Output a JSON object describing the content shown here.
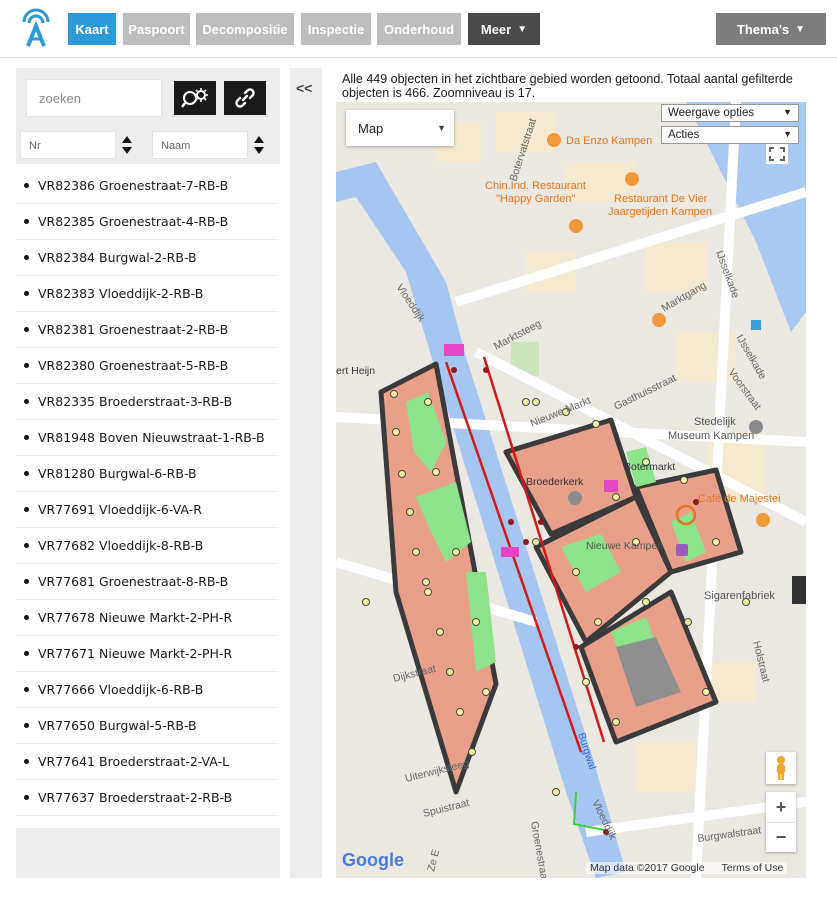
{
  "nav": {
    "tabs": [
      {
        "label": "Kaart"
      },
      {
        "label": "Paspoort"
      },
      {
        "label": "Decompositie"
      },
      {
        "label": "Inspectie"
      },
      {
        "label": "Onderhoud"
      },
      {
        "label": "Meer"
      }
    ],
    "themes_label": "Thema's",
    "active_tab": "Kaart",
    "colors": {
      "active": "#2d9ad8",
      "inactive": "#bdbdbd",
      "dark": "#4a4a4a"
    }
  },
  "sidebar": {
    "search_placeholder": "zoeken",
    "sort_nr": "Nr",
    "sort_naam": "Naam",
    "items": [
      {
        "id": "VR82386",
        "name": "Groenestraat-7-RB-B"
      },
      {
        "id": "VR82385",
        "name": "Groenestraat-4-RB-B"
      },
      {
        "id": "VR82384",
        "name": "Burgwal-2-RB-B"
      },
      {
        "id": "VR82383",
        "name": "Vloeddijk-2-RB-B"
      },
      {
        "id": "VR82381",
        "name": "Groenestraat-2-RB-B"
      },
      {
        "id": "VR82380",
        "name": "Groenestraat-5-RB-B"
      },
      {
        "id": "VR82335",
        "name": "Broederstraat-3-RB-B"
      },
      {
        "id": "VR81948",
        "name": "Boven Nieuwstraat-1-RB-B"
      },
      {
        "id": "VR81280",
        "name": "Burgwal-6-RB-B"
      },
      {
        "id": "VR77691",
        "name": "Vloeddijk-6-VA-R"
      },
      {
        "id": "VR77682",
        "name": "Vloeddijk-8-RB-B"
      },
      {
        "id": "VR77681",
        "name": "Groenestraat-8-RB-B"
      },
      {
        "id": "VR77678",
        "name": "Nieuwe Markt-2-PH-R"
      },
      {
        "id": "VR77671",
        "name": "Nieuwe Markt-2-PH-R"
      },
      {
        "id": "VR77666",
        "name": "Vloeddijk-6-RB-B"
      },
      {
        "id": "VR77650",
        "name": "Burgwal-5-RB-B"
      },
      {
        "id": "VR77641",
        "name": "Broederstraat-2-VA-L"
      },
      {
        "id": "VR77637",
        "name": "Broederstraat-2-RB-B"
      }
    ]
  },
  "collapse_label": "<<",
  "map": {
    "info": "Alle 449 objecten in het zichtbare gebied worden getoond. Totaal aantal gefilterde objecten is 466. Zoomniveau is 17.",
    "map_type": "Map",
    "display_options": "Weergave opties",
    "actions": "Acties",
    "zoom_in": "+",
    "zoom_out": "−",
    "google": "Google",
    "map_data": "Map data ©2017 Google",
    "terms": "Terms of Use",
    "labels": {
      "botervatstraat": "Botervatstraat",
      "da_enzo": "Da Enzo Kampen",
      "chin_1": "Chin.Ind. Restaurant",
      "chin_2": "\"Happy Garden\"",
      "vier_1": "Restaurant De Vier",
      "vier_2": "Jaargetijden Kampen",
      "ijsselkade_top": "IJsselkade",
      "vloeddijk_1": "Vloeddijk",
      "markt_steeg": "Marktsteeg",
      "marktgang": "Marktgang",
      "ijsselkade": "IJsselkade",
      "heijn": "ert Heijn",
      "nieuwe_markt": "Nieuwe Markt",
      "gasthuisstraat": "Gasthuisstraat",
      "vooratraat": "Voorstraat",
      "stedelijk": "Stedelijk",
      "museum": "Museum Kampen",
      "botermarkt": "Botermarkt",
      "broederkerk": "Broederkerk",
      "cafe": "Café de Majestei",
      "nieuwe_kampen": "Nieuwe Kampen",
      "sigaren": "Sigarenfabriek",
      "dijkstraat": "Dijkstraat",
      "holstraat": "Holstraat",
      "uiterwijk": "Uiterwijksteeg",
      "spuistraat": "Spuistraat",
      "burgwal": "Burgwal",
      "burgwalstraat": "Burgwalstraat",
      "vloeddijk_2": "Vloeddijk",
      "groenestraat": "Groenestraat",
      "ze_e": "Ze E"
    }
  }
}
